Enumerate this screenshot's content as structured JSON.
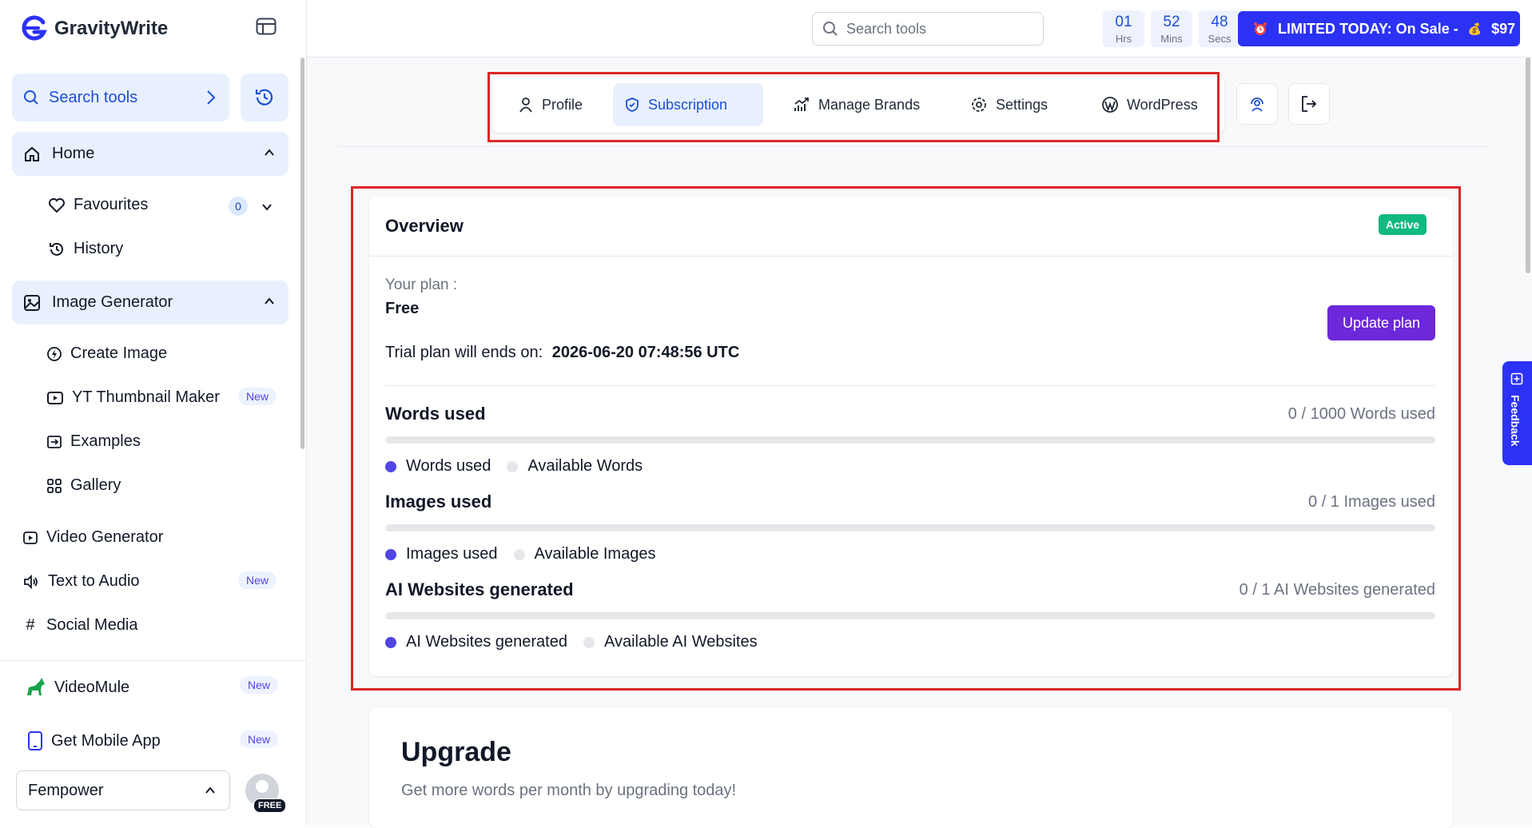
{
  "app": {
    "name": "GravityWrite"
  },
  "sidebar": {
    "search_label": "Search tools",
    "home": "Home",
    "favourites": "Favourites",
    "favourites_count": "0",
    "history": "History",
    "image_generator": "Image Generator",
    "create_image": "Create Image",
    "yt_thumbnail": "YT Thumbnail Maker",
    "examples": "Examples",
    "gallery": "Gallery",
    "video_generator": "Video Generator",
    "text_to_audio": "Text to Audio",
    "social_media": "Social Media",
    "videomule": "VideoMule",
    "mobile_app": "Get Mobile App",
    "new_badge": "New",
    "workspace": "Fempower",
    "plan_tag": "FREE"
  },
  "topbar": {
    "search_placeholder": "Search tools",
    "timer": {
      "hrs": "01",
      "hrs_label": "Hrs",
      "mins": "52",
      "mins_label": "Mins",
      "secs": "48",
      "secs_label": "Secs"
    },
    "sale_text": "LIMITED TODAY: On Sale -",
    "sale_emoji": "💰",
    "sale_price": "$97"
  },
  "tabs": [
    {
      "label": "Profile"
    },
    {
      "label": "Subscription",
      "active": true
    },
    {
      "label": "Manage Brands"
    },
    {
      "label": "Settings"
    },
    {
      "label": "WordPress"
    }
  ],
  "overview": {
    "title": "Overview",
    "status": "Active",
    "plan_label": "Your plan :",
    "plan_value": "Free",
    "trial_label": "Trial plan will ends on:",
    "trial_date": "2026-06-20 07:48:56 UTC",
    "update_button": "Update plan",
    "usage": [
      {
        "title": "Words used",
        "count": "0 / 1000 Words used",
        "used_fraction": 0,
        "legend_used": "Words used",
        "legend_available": "Available Words"
      },
      {
        "title": "Images used",
        "count": "0 / 1 Images used",
        "used_fraction": 0,
        "legend_used": "Images used",
        "legend_available": "Available Images"
      },
      {
        "title": "AI Websites generated",
        "count": "0 / 1 AI Websites generated",
        "used_fraction": 0,
        "legend_used": "AI Websites generated",
        "legend_available": "Available AI Websites"
      }
    ]
  },
  "upgrade": {
    "title": "Upgrade",
    "subtitle": "Get more words per month by upgrading today!"
  },
  "feedback": {
    "label": "Feedback"
  },
  "colors": {
    "accent": "#2b32f5",
    "primary_purple": "#6d28d9",
    "active_green": "#10b981",
    "used_dot": "#4f46e5",
    "available_dot": "#e5e7eb",
    "highlight_frame": "#dc2626"
  }
}
